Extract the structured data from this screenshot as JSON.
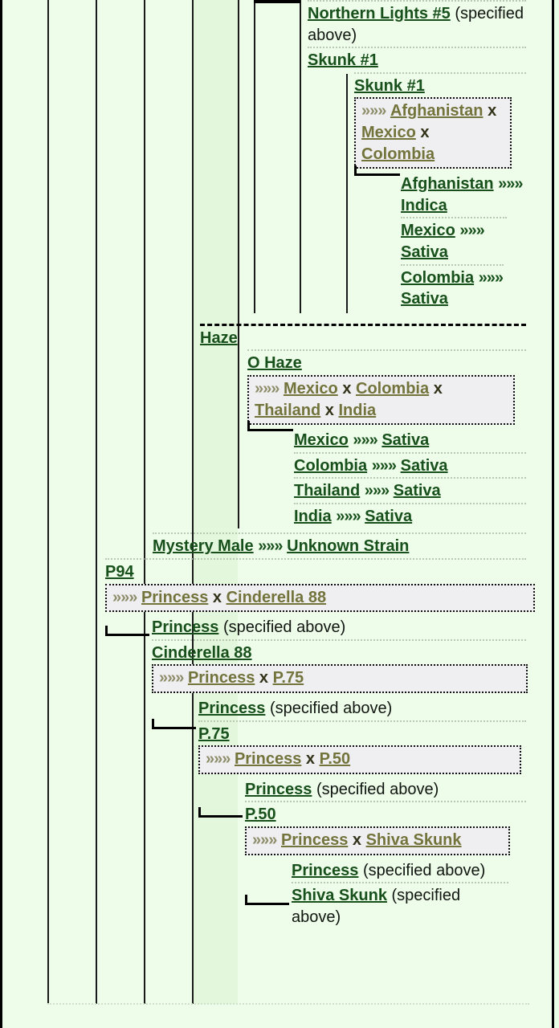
{
  "page": {
    "type": "strain-genealogy-tree",
    "colors": {
      "background": "#eefdea",
      "link": "#17501b",
      "cross_link": "#73733c",
      "cross_background": "#efeff1",
      "rule": "#b9c9b4",
      "border": "#000000"
    },
    "arrow_glyph": "»»»",
    "specified_above": "(specified above)",
    "x_separator": "x"
  },
  "nodes": [
    {
      "id": "northern-lights-5",
      "name": "Northern Lights #5",
      "note": "(specified above)",
      "indent": 6
    },
    {
      "id": "skunk-1-parent",
      "name": "Skunk #1",
      "indent": 6
    },
    {
      "id": "skunk-1-child",
      "name": "Skunk #1",
      "indent": 7,
      "cross": {
        "arrow": "»»»",
        "parts": [
          "Afghanistan",
          "Mexico",
          "Colombia"
        ],
        "text": "»»» Afghanistan x Mexico x Colombia"
      }
    },
    {
      "id": "afghanistan",
      "name": "Afghanistan",
      "arrow": "»»»",
      "value": "Indica",
      "indent": 8
    },
    {
      "id": "mexico-1",
      "name": "Mexico",
      "arrow": "»»»",
      "value": "Sativa",
      "indent": 8
    },
    {
      "id": "colombia-1",
      "name": "Colombia",
      "arrow": "»»»",
      "value": "Sativa",
      "indent": 8
    },
    {
      "id": "haze",
      "name": "Haze",
      "indent": 4
    },
    {
      "id": "o-haze",
      "name": "O Haze",
      "indent": 5,
      "cross": {
        "arrow": "»»»",
        "parts": [
          "Mexico",
          "Colombia",
          "Thailand",
          "India"
        ],
        "text": "»»» Mexico x Colombia x Thailand x India"
      }
    },
    {
      "id": "mexico-2",
      "name": "Mexico",
      "arrow": "»»»",
      "value": "Sativa",
      "indent": 6
    },
    {
      "id": "colombia-2",
      "name": "Colombia",
      "arrow": "»»»",
      "value": "Sativa",
      "indent": 6
    },
    {
      "id": "thailand",
      "name": "Thailand",
      "arrow": "»»»",
      "value": "Sativa",
      "indent": 6
    },
    {
      "id": "india",
      "name": "India",
      "arrow": "»»»",
      "value": "Sativa",
      "indent": 6
    },
    {
      "id": "mystery-male",
      "name": "Mystery Male",
      "arrow": "»»»",
      "value": "Unknown Strain",
      "indent": 3
    },
    {
      "id": "p94",
      "name": "P94",
      "indent": 2,
      "cross": {
        "arrow": "»»»",
        "parts": [
          "Princess",
          "Cinderella 88"
        ],
        "text": "»»» Princess x Cinderella 88"
      }
    },
    {
      "id": "princess-1",
      "name": "Princess",
      "note": "(specified above)",
      "indent": 3
    },
    {
      "id": "cinderella-88",
      "name": "Cinderella 88",
      "indent": 3,
      "cross": {
        "arrow": "»»»",
        "parts": [
          "Princess",
          "P.75"
        ],
        "text": "»»» Princess x P.75"
      }
    },
    {
      "id": "princess-2",
      "name": "Princess",
      "note": "(specified above)",
      "indent": 4
    },
    {
      "id": "p75",
      "name": "P.75",
      "indent": 4,
      "cross": {
        "arrow": "»»»",
        "parts": [
          "Princess",
          "P.50"
        ],
        "text": "»»» Princess x P.50"
      }
    },
    {
      "id": "princess-3",
      "name": "Princess",
      "note": "(specified above)",
      "indent": 5
    },
    {
      "id": "p50",
      "name": "P.50",
      "indent": 5,
      "cross": {
        "arrow": "»»»",
        "parts": [
          "Princess",
          "Shiva Skunk"
        ],
        "text": "»»» Princess x Shiva Skunk"
      }
    },
    {
      "id": "princess-4",
      "name": "Princess",
      "note": "(specified above)",
      "indent": 6
    },
    {
      "id": "shiva-skunk",
      "name": "Shiva Skunk",
      "note": "(specified above)",
      "indent": 6
    }
  ]
}
